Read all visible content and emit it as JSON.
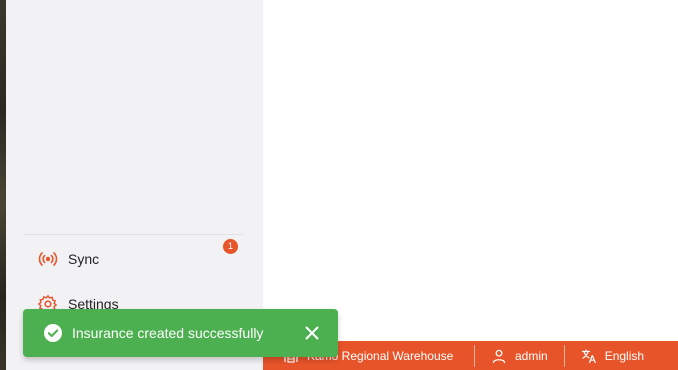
{
  "sidebar": {
    "items": [
      {
        "label": "Sync",
        "icon": "broadcast-icon",
        "badge": "1"
      },
      {
        "label": "Settings",
        "icon": "gear-icon"
      }
    ]
  },
  "footer": {
    "warehouse": "Kamo Regional Warehouse",
    "user": "admin",
    "language": "English"
  },
  "toast": {
    "message": "Insurance created successfully",
    "type": "success"
  },
  "colors": {
    "accent": "#e8542a",
    "success": "#4caf50",
    "sidebar_bg": "#f2f2f4"
  }
}
